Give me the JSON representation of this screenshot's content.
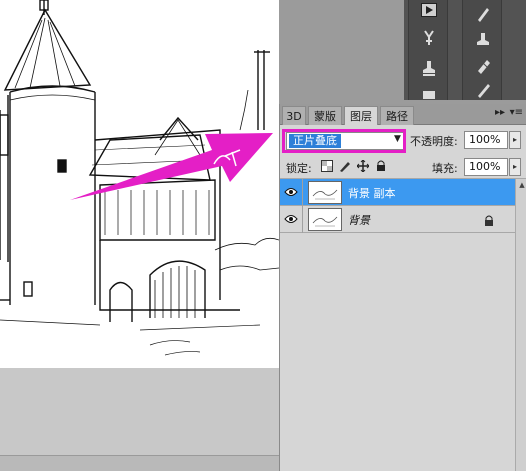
{
  "layers_panel": {
    "tabs": [
      {
        "label": "3D",
        "active": false
      },
      {
        "label": "蒙版",
        "active": false
      },
      {
        "label": "图层",
        "active": true
      },
      {
        "label": "路径",
        "active": false
      }
    ],
    "blend_mode": "正片叠底",
    "opacity_label": "不透明度:",
    "opacity_value": "100%",
    "lock_label": "锁定:",
    "fill_label": "填充:",
    "fill_value": "100%",
    "layers": [
      {
        "name": "背景 副本",
        "selected": true,
        "visible": true,
        "locked": false
      },
      {
        "name": "背景",
        "selected": false,
        "visible": true,
        "locked": true
      }
    ]
  },
  "colors": {
    "highlight": "#e41fc6",
    "selection": "#3c99f0",
    "panel_bg": "#d6d6d6"
  },
  "icons": {
    "tools_left": [
      "play-icon",
      "stamp-tool-icon",
      "history-brush-icon",
      "paint-bucket-icon"
    ],
    "tools_right": [
      "brush-icon",
      "clone-stamp-icon",
      "eraser-icon",
      "gradient-icon"
    ]
  }
}
